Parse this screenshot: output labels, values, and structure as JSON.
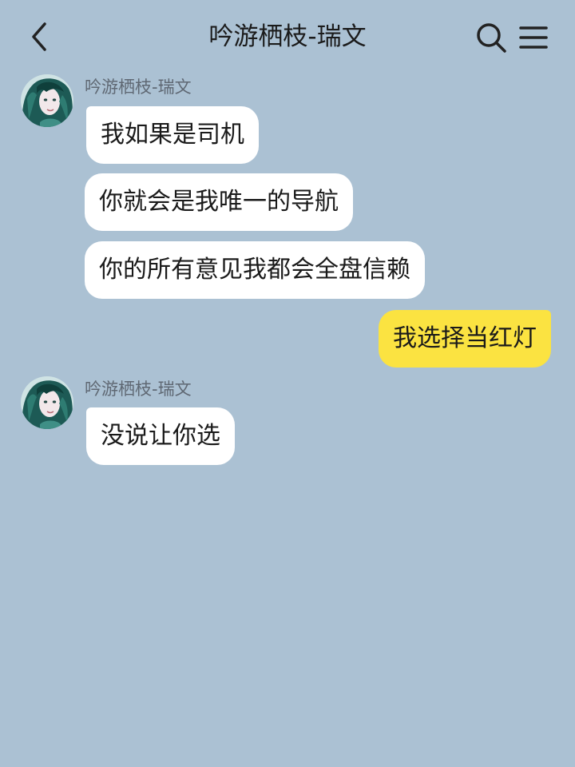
{
  "header": {
    "title": "吟游栖枝-瑞文",
    "back_icon": "chevron-left-icon",
    "search_icon": "search-icon",
    "menu_icon": "hamburger-menu-icon"
  },
  "colors": {
    "background": "#abc1d3",
    "incoming_bubble": "#ffffff",
    "outgoing_bubble": "#fbe341"
  },
  "messages": [
    {
      "group": "incoming",
      "sender": "吟游栖枝-瑞文",
      "bubbles": [
        "我如果是司机",
        "你就会是我唯一的导航",
        "你的所有意见我都会全盘信赖"
      ]
    },
    {
      "group": "outgoing",
      "bubbles": [
        "我选择当红灯"
      ]
    },
    {
      "group": "incoming",
      "sender": "吟游栖枝-瑞文",
      "bubbles": [
        "没说让你选"
      ]
    }
  ]
}
